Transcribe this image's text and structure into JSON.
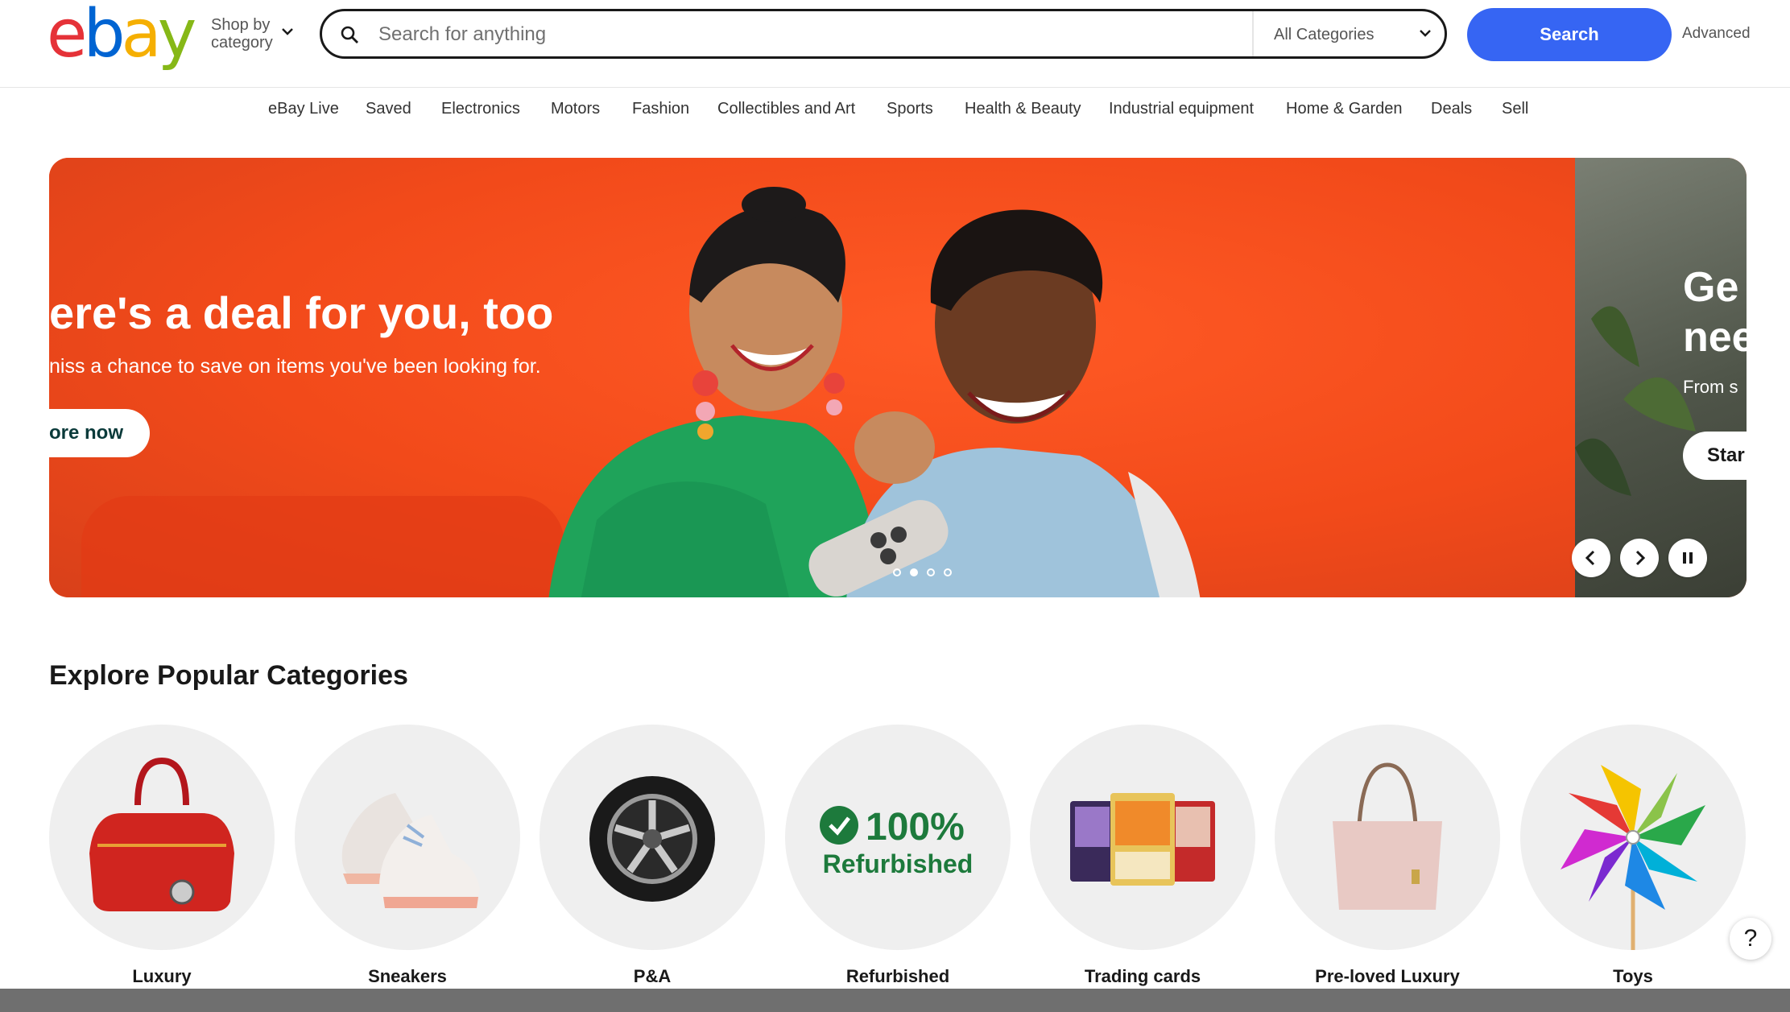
{
  "header": {
    "logo_letters": [
      "e",
      "b",
      "a",
      "y"
    ],
    "shop_by_category": "Shop by category",
    "search_placeholder": "Search for anything",
    "category_select": "All Categories",
    "search_button": "Search",
    "advanced_link": "Advanced"
  },
  "nav": {
    "items": [
      "eBay Live",
      "Saved",
      "Electronics",
      "Motors",
      "Fashion",
      "Collectibles and Art",
      "Sports",
      "Health & Beauty",
      "Industrial equipment",
      "Home & Garden",
      "Deals",
      "Sell"
    ]
  },
  "hero": {
    "headline": "ere's a deal for you, too",
    "subline": "niss a chance to save on items you've been looking for.",
    "cta": "ore now",
    "next_slide": {
      "title_line1": "Ge",
      "title_line2": "nee",
      "subtitle": "From s",
      "cta": "Star"
    },
    "colors": {
      "primary_bg": "#f24c1c",
      "sweater": "#1fa35a"
    },
    "slide_count": 4,
    "active_slide": 2
  },
  "categories": {
    "title": "Explore Popular Categories",
    "items": [
      {
        "label": "Luxury",
        "icon": "red-handbag"
      },
      {
        "label": "Sneakers",
        "icon": "sneakers"
      },
      {
        "label": "P&A",
        "icon": "car-wheel"
      },
      {
        "label": "Refurbished",
        "icon": "refurbished-badge",
        "badge_percent": "100%",
        "badge_text": "Refurbished"
      },
      {
        "label": "Trading cards",
        "icon": "trading-cards"
      },
      {
        "label": "Pre-loved Luxury",
        "icon": "pink-tote-bag"
      },
      {
        "label": "Toys",
        "icon": "pinwheel"
      }
    ]
  },
  "help_button": "?",
  "colors": {
    "accent": "#3665f3",
    "refurb_green": "#1d7a3c"
  }
}
